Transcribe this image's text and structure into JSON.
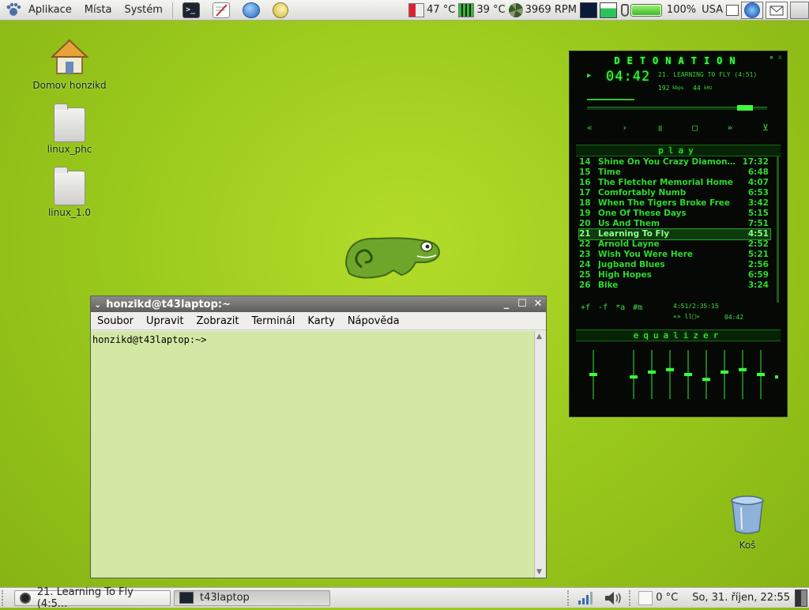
{
  "top_panel": {
    "menus": [
      "Aplikace",
      "Místa",
      "Systém"
    ],
    "launchers": [
      "terminal-icon",
      "text-editor-icon",
      "browser-icon",
      "screensaver-icon"
    ],
    "tray": {
      "cpu_temp": "47 °C",
      "gpu_temp": "39 °C",
      "fan_speed": "3969 RPM",
      "battery_level": 1.0,
      "battery_text": "100%",
      "keyboard_layout": "USA"
    }
  },
  "desktop": {
    "icons": [
      {
        "label": "Domov honzikd",
        "icon": "home-folder-icon"
      },
      {
        "label": "linux_phc",
        "icon": "folder-icon"
      },
      {
        "label": "linux_1.0",
        "icon": "folder-icon"
      },
      {
        "label": "Koš",
        "icon": "trash-icon"
      }
    ]
  },
  "terminal": {
    "title": "honzikd@t43laptop:~",
    "menu": [
      "Soubor",
      "Upravit",
      "Zobrazit",
      "Terminál",
      "Karty",
      "Nápověda"
    ],
    "prompt": "honzikd@t43laptop:~>",
    "controls": {
      "minimize": "_",
      "maximize": "☐",
      "close": "✕"
    }
  },
  "player": {
    "skin_title": "DETONATION",
    "time": "04:42",
    "song_title": "21. LEARNING TO FLY (4:51)",
    "bitrate": "192",
    "bitrate_unit": "kbps",
    "samplerate": "44",
    "samplerate_unit": "kHz",
    "playlist_label": "play",
    "equalizer_label": "equalizer",
    "transport": [
      "«",
      "›",
      "॥",
      "□",
      "»",
      "⊻"
    ],
    "playlist_buttons": [
      "+f",
      "-f",
      "*a",
      "#m"
    ],
    "total_time": "4:51/2:35:15",
    "small_time": "04:42",
    "mini_controls": "«» ll□» ",
    "current_track_number": "21",
    "playlist": [
      {
        "n": "14",
        "title": "Shine On You Crazy Diamond ...",
        "dur": "17:32"
      },
      {
        "n": "15",
        "title": "Time",
        "dur": "6:48"
      },
      {
        "n": "16",
        "title": "The Fletcher Memorial Home",
        "dur": "4:07"
      },
      {
        "n": "17",
        "title": "Comfortably Numb",
        "dur": "6:53"
      },
      {
        "n": "18",
        "title": "When The Tigers Broke Free",
        "dur": "3:42"
      },
      {
        "n": "19",
        "title": "One Of These Days",
        "dur": "5:15"
      },
      {
        "n": "20",
        "title": "Us And Them",
        "dur": "7:51"
      },
      {
        "n": "21",
        "title": "Learning To Fly",
        "dur": "4:51"
      },
      {
        "n": "22",
        "title": "Arnold Layne",
        "dur": "2:52"
      },
      {
        "n": "23",
        "title": "Wish You Were Here",
        "dur": "5:21"
      },
      {
        "n": "24",
        "title": "Jugband Blues",
        "dur": "2:56"
      },
      {
        "n": "25",
        "title": "High Hopes",
        "dur": "6:59"
      },
      {
        "n": "26",
        "title": "Bike",
        "dur": "3:24"
      }
    ],
    "eq_bands": [
      0.5,
      0.45,
      0.55,
      0.6,
      0.5,
      0.4,
      0.55,
      0.6,
      0.5,
      0.45
    ],
    "accent": "#3aff3a"
  },
  "bottom_panel": {
    "tasks": [
      {
        "label": "21. Learning To Fly (4:5...",
        "icon": "audacious-icon",
        "active": false
      },
      {
        "label": "t43laptop",
        "icon": "terminal-icon",
        "active": true
      }
    ],
    "weather": "0 °C",
    "clock": "So, 31. říjen, 22:55"
  }
}
